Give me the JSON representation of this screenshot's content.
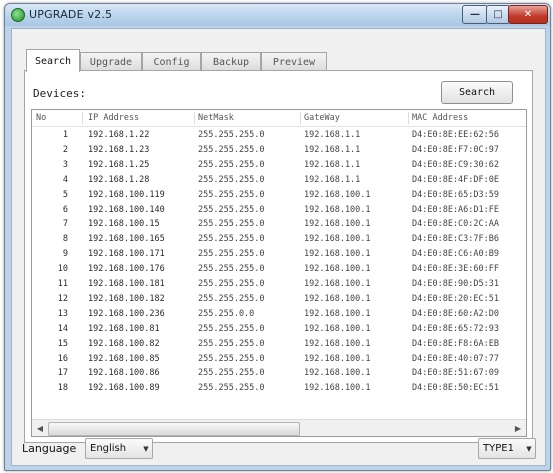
{
  "window": {
    "title": "UPGRADE v2.5"
  },
  "tabs": [
    {
      "label": "Search",
      "active": true
    },
    {
      "label": "Upgrade",
      "active": false
    },
    {
      "label": "Config",
      "active": false
    },
    {
      "label": "Backup",
      "active": false
    },
    {
      "label": "Preview",
      "active": false
    }
  ],
  "search_panel": {
    "devices_label": "Devices:",
    "search_button": "Search",
    "columns": [
      "No",
      "IP Address",
      "NetMask",
      "GateWay",
      "MAC Address"
    ],
    "rows": [
      {
        "no": "1",
        "ip": "192.168.1.22",
        "mask": "255.255.255.0",
        "gw": "192.168.1.1",
        "mac": "D4:E0:8E:EE:62:56"
      },
      {
        "no": "2",
        "ip": "192.168.1.23",
        "mask": "255.255.255.0",
        "gw": "192.168.1.1",
        "mac": "D4:E0:8E:F7:0C:97"
      },
      {
        "no": "3",
        "ip": "192.168.1.25",
        "mask": "255.255.255.0",
        "gw": "192.168.1.1",
        "mac": "D4:E0:8E:C9:30:62"
      },
      {
        "no": "4",
        "ip": "192.168.1.28",
        "mask": "255.255.255.0",
        "gw": "192.168.1.1",
        "mac": "D4:E0:8E:4F:DF:0E"
      },
      {
        "no": "5",
        "ip": "192.168.100.119",
        "mask": "255.255.255.0",
        "gw": "192.168.100.1",
        "mac": "D4:E0:8E:65:D3:59"
      },
      {
        "no": "6",
        "ip": "192.168.100.140",
        "mask": "255.255.255.0",
        "gw": "192.168.100.1",
        "mac": "D4:E0:8E:A6:D1:FE"
      },
      {
        "no": "7",
        "ip": "192.168.100.15",
        "mask": "255.255.255.0",
        "gw": "192.168.100.1",
        "mac": "D4:E0:8E:C0:2C:AA"
      },
      {
        "no": "8",
        "ip": "192.168.100.165",
        "mask": "255.255.255.0",
        "gw": "192.168.100.1",
        "mac": "D4:E0:8E:C3:7F:B6"
      },
      {
        "no": "9",
        "ip": "192.168.100.171",
        "mask": "255.255.255.0",
        "gw": "192.168.100.1",
        "mac": "D4:E0:8E:C6:A0:B9"
      },
      {
        "no": "10",
        "ip": "192.168.100.176",
        "mask": "255.255.255.0",
        "gw": "192.168.100.1",
        "mac": "D4:E0:8E:3E:60:FF"
      },
      {
        "no": "11",
        "ip": "192.168.100.181",
        "mask": "255.255.255.0",
        "gw": "192.168.100.1",
        "mac": "D4:E0:8E:90:D5:31"
      },
      {
        "no": "12",
        "ip": "192.168.100.182",
        "mask": "255.255.255.0",
        "gw": "192.168.100.1",
        "mac": "D4:E0:8E:20:EC:51"
      },
      {
        "no": "13",
        "ip": "192.168.100.236",
        "mask": "255.255.0.0",
        "gw": "192.168.100.1",
        "mac": "D4:E0:8E:60:A2:D0"
      },
      {
        "no": "14",
        "ip": "192.168.100.81",
        "mask": "255.255.255.0",
        "gw": "192.168.100.1",
        "mac": "D4:E0:8E:65:72:93"
      },
      {
        "no": "15",
        "ip": "192.168.100.82",
        "mask": "255.255.255.0",
        "gw": "192.168.100.1",
        "mac": "D4:E0:8E:F8:6A:EB"
      },
      {
        "no": "16",
        "ip": "192.168.100.85",
        "mask": "255.255.255.0",
        "gw": "192.168.100.1",
        "mac": "D4:E0:8E:40:07:77"
      },
      {
        "no": "17",
        "ip": "192.168.100.86",
        "mask": "255.255.255.0",
        "gw": "192.168.100.1",
        "mac": "D4:E0:8E:51:67:09"
      },
      {
        "no": "18",
        "ip": "192.168.100.89",
        "mask": "255.255.255.0",
        "gw": "192.168.100.1",
        "mac": "D4:E0:8E:50:EC:51"
      }
    ]
  },
  "footer": {
    "language_label": "Language",
    "language_value": "English",
    "type_value": "TYPE1"
  },
  "icons": {
    "app": "app-globe-icon",
    "minimize": "minimize-icon",
    "maximize": "maximize-icon",
    "close": "close-icon",
    "dropdown": "chevron-down-icon"
  },
  "colors": {
    "close_button": "#c0392b",
    "title_bar": "#bcd5ee"
  }
}
